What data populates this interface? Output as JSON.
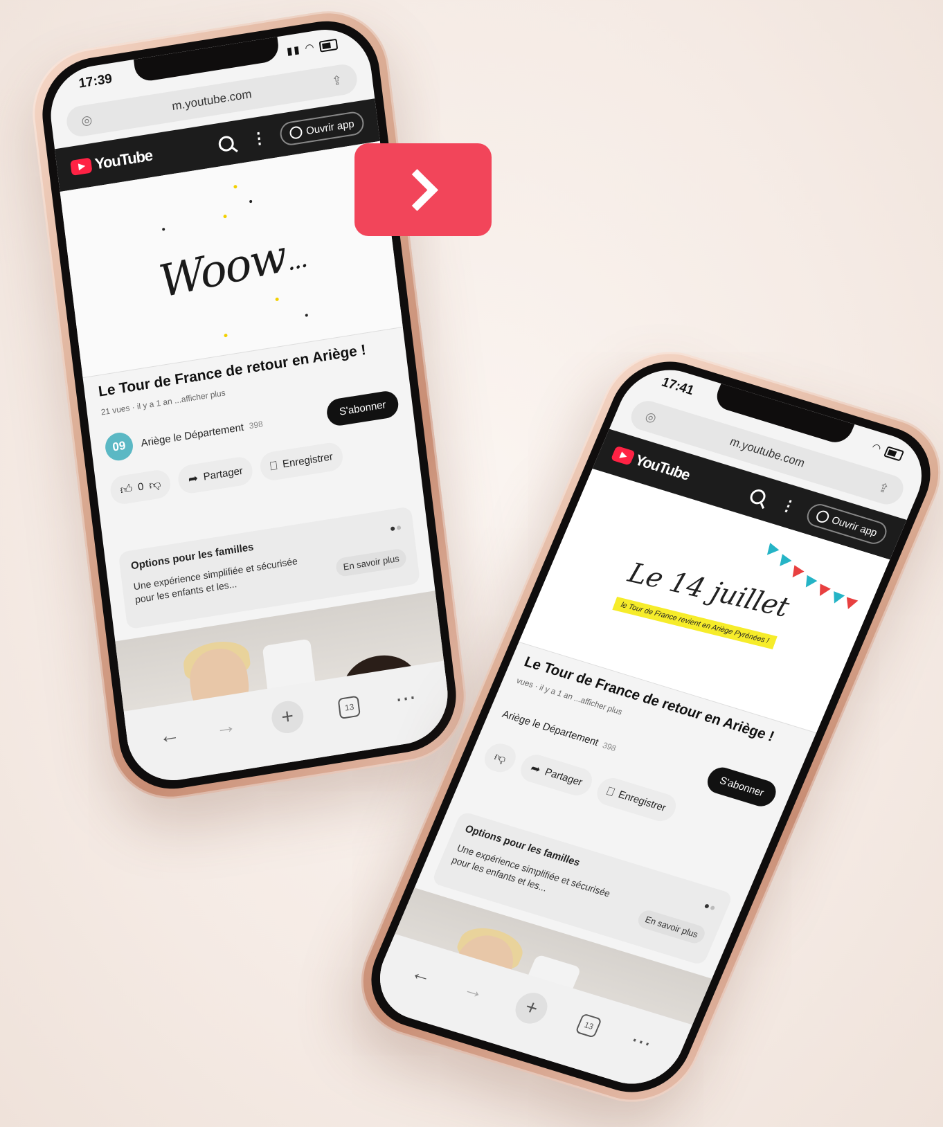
{
  "colors": {
    "accent": "#f2455a",
    "youtube_red": "#ff2244",
    "header_bg": "#1c1c1c"
  },
  "phone1": {
    "status": {
      "time": "17:39"
    },
    "browser": {
      "url": "m.youtube.com",
      "tab_count": "13"
    },
    "header": {
      "logo": "YouTube",
      "open_app": "Ouvrir app"
    },
    "video": {
      "overlay_text": "Woow",
      "overlay_ellipsis": "..."
    },
    "meta": {
      "title": "Le Tour de France de retour en Ariège !",
      "sub": "21 vues · il y a 1 an  ...afficher plus",
      "channel_avatar": "09",
      "channel_name": "Ariège le Département",
      "channel_subs": "398",
      "subscribe": "S'abonner",
      "likes": "0",
      "share": "Partager",
      "save": "Enregistrer"
    },
    "family": {
      "title": "Options pour les familles",
      "desc": "Une expérience simplifiée et sécurisée pour les enfants et les...",
      "link": "En savoir plus"
    }
  },
  "phone2": {
    "status": {
      "time": "17:41"
    },
    "browser": {
      "url": "m.youtube.com",
      "tab_count": "13"
    },
    "header": {
      "logo": "YouTube",
      "open_app": "Ouvrir app"
    },
    "video": {
      "overlay_text": "Le 14 juillet",
      "tagline": "le Tour de France revient en Ariège Pyrénées !"
    },
    "meta": {
      "title": "Le Tour de France de retour en Ariège !",
      "sub": "vues · il y a 1 an  ...afficher plus",
      "channel_name": "Ariège le Département",
      "channel_subs": "398",
      "subscribe": "S'abonner",
      "share": "Partager",
      "save": "Enregistrer"
    },
    "family": {
      "title": "Options pour les familles",
      "desc": "Une expérience simplifiée et sécurisée pour les enfants et les...",
      "link": "En savoir plus"
    }
  },
  "icons": {
    "next": "chevron-right-icon",
    "search": "search-icon",
    "more": "more-vertical-icon",
    "user": "user-circle-icon",
    "like": "thumbs-up-icon",
    "dislike": "thumbs-down-icon",
    "share": "share-icon",
    "save": "bookmark-icon",
    "back": "arrow-left-icon",
    "forward": "arrow-right-icon",
    "new_tab": "plus-icon",
    "tabs": "tabs-icon",
    "menu": "more-horizontal-icon"
  }
}
